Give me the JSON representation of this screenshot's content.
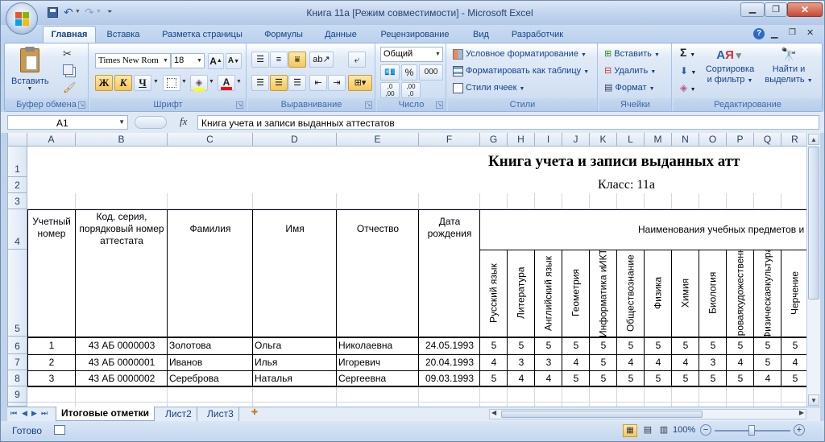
{
  "window": {
    "title": "Книга 11а  [Режим совместимости] - Microsoft Excel"
  },
  "tabs": [
    "Главная",
    "Вставка",
    "Разметка страницы",
    "Формулы",
    "Данные",
    "Рецензирование",
    "Вид",
    "Разработчик"
  ],
  "ribbon": {
    "clipboard": {
      "paste": "Вставить",
      "label": "Буфер обмена"
    },
    "font": {
      "name": "Times New Rom",
      "size": "18",
      "bold": "Ж",
      "italic": "К",
      "underline": "Ч",
      "label": "Шрифт"
    },
    "alignment": {
      "label": "Выравнивание"
    },
    "number": {
      "format": "Общий",
      "label": "Число",
      "percent": "%",
      "thousands": "000"
    },
    "styles": {
      "conditional": "Условное форматирование",
      "table": "Форматировать как таблицу",
      "cell_styles": "Стили ячеек",
      "label": "Стили"
    },
    "cells": {
      "insert": "Вставить",
      "delete": "Удалить",
      "format": "Формат",
      "label": "Ячейки"
    },
    "editing": {
      "sort_line1": "Сортировка",
      "sort_line2": "и фильтр",
      "find_line1": "Найти и",
      "find_line2": "выделить",
      "label": "Редактирование"
    }
  },
  "formula_bar": {
    "name_box": "A1",
    "fx": "fx",
    "content": "Книга учета и записи выданных аттестатов"
  },
  "columns": [
    "A",
    "B",
    "C",
    "D",
    "E",
    "F",
    "G",
    "H",
    "I",
    "J",
    "K",
    "L",
    "M",
    "N",
    "O",
    "P",
    "Q",
    "R"
  ],
  "rows": [
    "1",
    "2",
    "3",
    "4",
    "5",
    "6",
    "7",
    "8",
    "9"
  ],
  "sheet": {
    "title": "Книга учета и записи выданных атт",
    "class_label": "Класс: 11а",
    "headers": {
      "num": "Учетный номер",
      "code_line1": "Код, серия,",
      "code_line2": "порядковый номер",
      "code_line3": "аттестата",
      "surname": "Фамилия",
      "name": "Имя",
      "patronymic": "Отчество",
      "dob_line1": "Дата",
      "dob_line2": "рождения",
      "subjects": "Наименования учебных предметов и"
    },
    "subjects": [
      {
        "l1": "Русский язык",
        "l2": ""
      },
      {
        "l1": "Литература",
        "l2": ""
      },
      {
        "l1": "Английский язык",
        "l2": ""
      },
      {
        "l1": "Геометрия",
        "l2": ""
      },
      {
        "l1": "Информатика и",
        "l2": "ИКТ"
      },
      {
        "l1": "Обществознание",
        "l2": ""
      },
      {
        "l1": "Физика",
        "l2": ""
      },
      {
        "l1": "Химия",
        "l2": ""
      },
      {
        "l1": "Биология",
        "l2": ""
      },
      {
        "l1": "Мировая",
        "l2": "художественная"
      },
      {
        "l1": "Физическая",
        "l2": "культура"
      },
      {
        "l1": "Черчение",
        "l2": ""
      }
    ],
    "students": [
      {
        "num": "1",
        "code": "43 АБ 0000003",
        "surname": "Золотова",
        "name": "Ольга",
        "patronymic": "Николаевна",
        "dob": "24.05.1993",
        "grades": [
          "5",
          "5",
          "5",
          "5",
          "5",
          "5",
          "5",
          "5",
          "5",
          "5",
          "5",
          "5"
        ]
      },
      {
        "num": "2",
        "code": "43 АБ 0000001",
        "surname": "Иванов",
        "name": "Илья",
        "patronymic": "Игоревич",
        "dob": "20.04.1993",
        "grades": [
          "4",
          "3",
          "3",
          "4",
          "5",
          "4",
          "4",
          "4",
          "3",
          "4",
          "5",
          "4"
        ]
      },
      {
        "num": "3",
        "code": "43 АБ 0000002",
        "surname": "Сереброва",
        "name": "Наталья",
        "patronymic": "Сергеевна",
        "dob": "09.03.1993",
        "grades": [
          "5",
          "4",
          "4",
          "5",
          "5",
          "5",
          "5",
          "5",
          "5",
          "5",
          "4",
          "5"
        ]
      }
    ]
  },
  "sheet_tabs": [
    "Итоговые отметки",
    "Лист2",
    "Лист3"
  ],
  "status": {
    "ready": "Готово",
    "zoom": "100%"
  }
}
